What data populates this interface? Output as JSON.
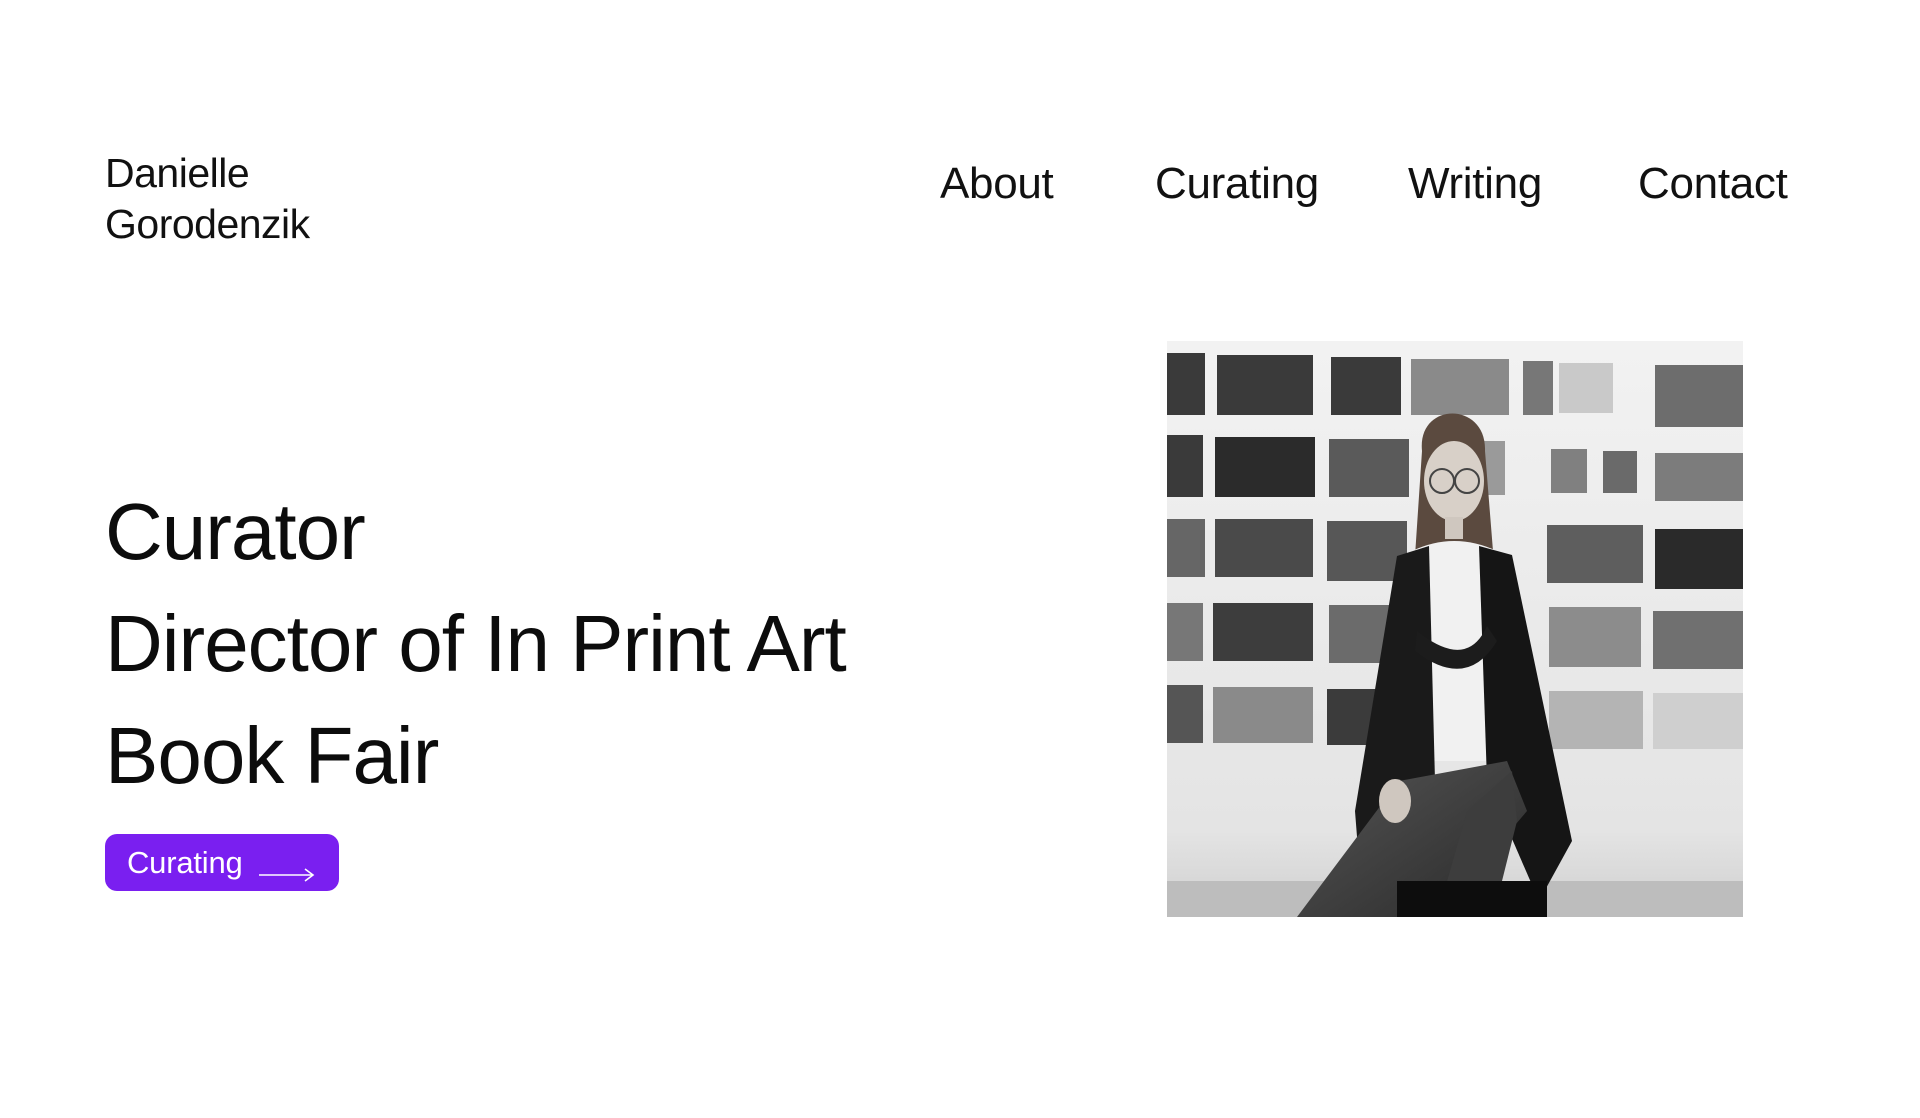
{
  "brand": {
    "line1": "Danielle",
    "line2": "Gorodenzik"
  },
  "nav": {
    "items": [
      {
        "label": "About"
      },
      {
        "label": "Curating"
      },
      {
        "label": "Writing"
      },
      {
        "label": "Contact"
      }
    ]
  },
  "hero": {
    "lines": [
      "Curator",
      "Director of In Print Art",
      "Book Fair"
    ],
    "cta_label": "Curating"
  },
  "colors": {
    "accent": "#7a1ff0",
    "text": "#111111",
    "background": "#ffffff"
  },
  "icons": {
    "cta_arrow": "arrow-right-icon"
  }
}
